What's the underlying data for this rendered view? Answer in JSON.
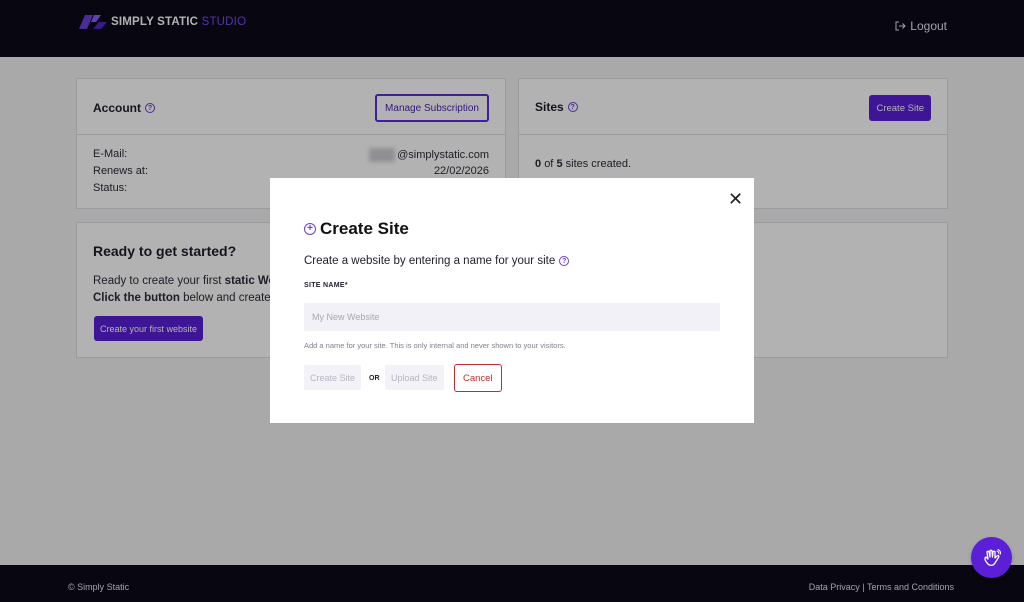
{
  "header": {
    "brand": "SIMPLY STATIC",
    "brand_suffix": "STUDIO",
    "logout_label": "Logout"
  },
  "account": {
    "title": "Account",
    "manage_button": "Manage Subscription",
    "rows": [
      {
        "label": "E-Mail:",
        "value": "@simplystatic.com"
      },
      {
        "label": "Renews at:",
        "value": "22/02/2026"
      },
      {
        "label": "Status:",
        "value": ""
      }
    ]
  },
  "sites": {
    "title": "Sites",
    "create_button": "Create Site",
    "count_used": "0",
    "count_of": "of",
    "count_total": "5",
    "count_suffix": "sites created."
  },
  "ready": {
    "title": "Ready to get started?",
    "line1_prefix": "Ready to create your first ",
    "line1_bold": "static Wo",
    "line2_bold": "Click the button",
    "line2_rest": " below and create y",
    "button": "Create your first website"
  },
  "modal": {
    "title": "Create Site",
    "description": "Create a website by entering a name for your site",
    "field_label": "SITE NAME*",
    "input_placeholder": "My New Website",
    "input_value": "",
    "help_text": "Add a name for your site. This is only internal and never shown to your visitors.",
    "create_button": "Create Site",
    "or_text": "OR",
    "upload_button": "Upload Site",
    "cancel_button": "Cancel"
  },
  "footer": {
    "copyright": "© Simply Static",
    "privacy_link": "Data Privacy",
    "separator": "|",
    "terms_link": "Terms and Conditions"
  },
  "colors": {
    "accent": "#5a1fd6",
    "dark_bar": "#0c0a18",
    "cancel_red": "#c62b2b"
  },
  "icons": [
    "logo-icon",
    "logout-icon",
    "help-icon",
    "plus-circle-icon",
    "close-icon",
    "waving-hand-icon"
  ]
}
